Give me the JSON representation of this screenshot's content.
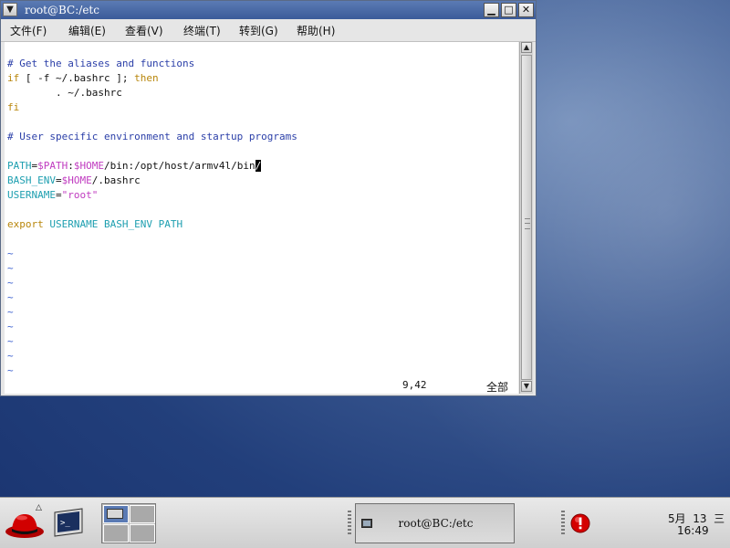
{
  "window": {
    "title": "root@BC:/etc",
    "menu_icon": "chevron-down-icon",
    "controls": [
      "minimize-icon",
      "maximize-icon",
      "close-icon"
    ]
  },
  "menu": [
    {
      "label": "文件(F)"
    },
    {
      "label": "编辑(E)"
    },
    {
      "label": "查看(V)"
    },
    {
      "label": "终端(T)"
    },
    {
      "label": "转到(G)"
    },
    {
      "label": "帮助(H)"
    }
  ],
  "editor": {
    "lines": {
      "l1": "# Get the aliases and functions",
      "l2_kw": "if",
      "l2_rest": " [ -f ~/.bashrc ]; ",
      "l2_then": "then",
      "l3": "        . ~/.bashrc",
      "l4": "fi",
      "l5": "# User specific environment and startup programs",
      "l6_var": "PATH",
      "l6_eq": "=",
      "l6_val1": "$PATH",
      "l6_colon": ":",
      "l6_val2": "$HOME",
      "l6_rest": "/bin:/opt/host/armv4l/bin",
      "l6_cursor": "/",
      "l7_var": "BASH_ENV",
      "l7_eq": "=",
      "l7_val": "$HOME",
      "l7_rest": "/.bashrc",
      "l8_var": "USERNAME",
      "l8_eq": "=",
      "l8_str": "\"root\"",
      "l9_kw": "export",
      "l9_rest": " USERNAME BASH_ENV PATH"
    },
    "tilde": "~",
    "status_position": "9,42",
    "status_scope": "全部"
  },
  "colors": {
    "comment": "#2b3fa8",
    "keyword": "#b8860b",
    "variable": "#c03cc0",
    "identifier": "#1e9fb0"
  },
  "panel": {
    "main_menu_icon": "redhat-icon",
    "terminal_launcher_icon": "terminal-icon",
    "task_label": "root@BC:/etc",
    "alert_icon": "alert-icon",
    "clock_date": "5月  13  三",
    "clock_time": "16:49"
  }
}
